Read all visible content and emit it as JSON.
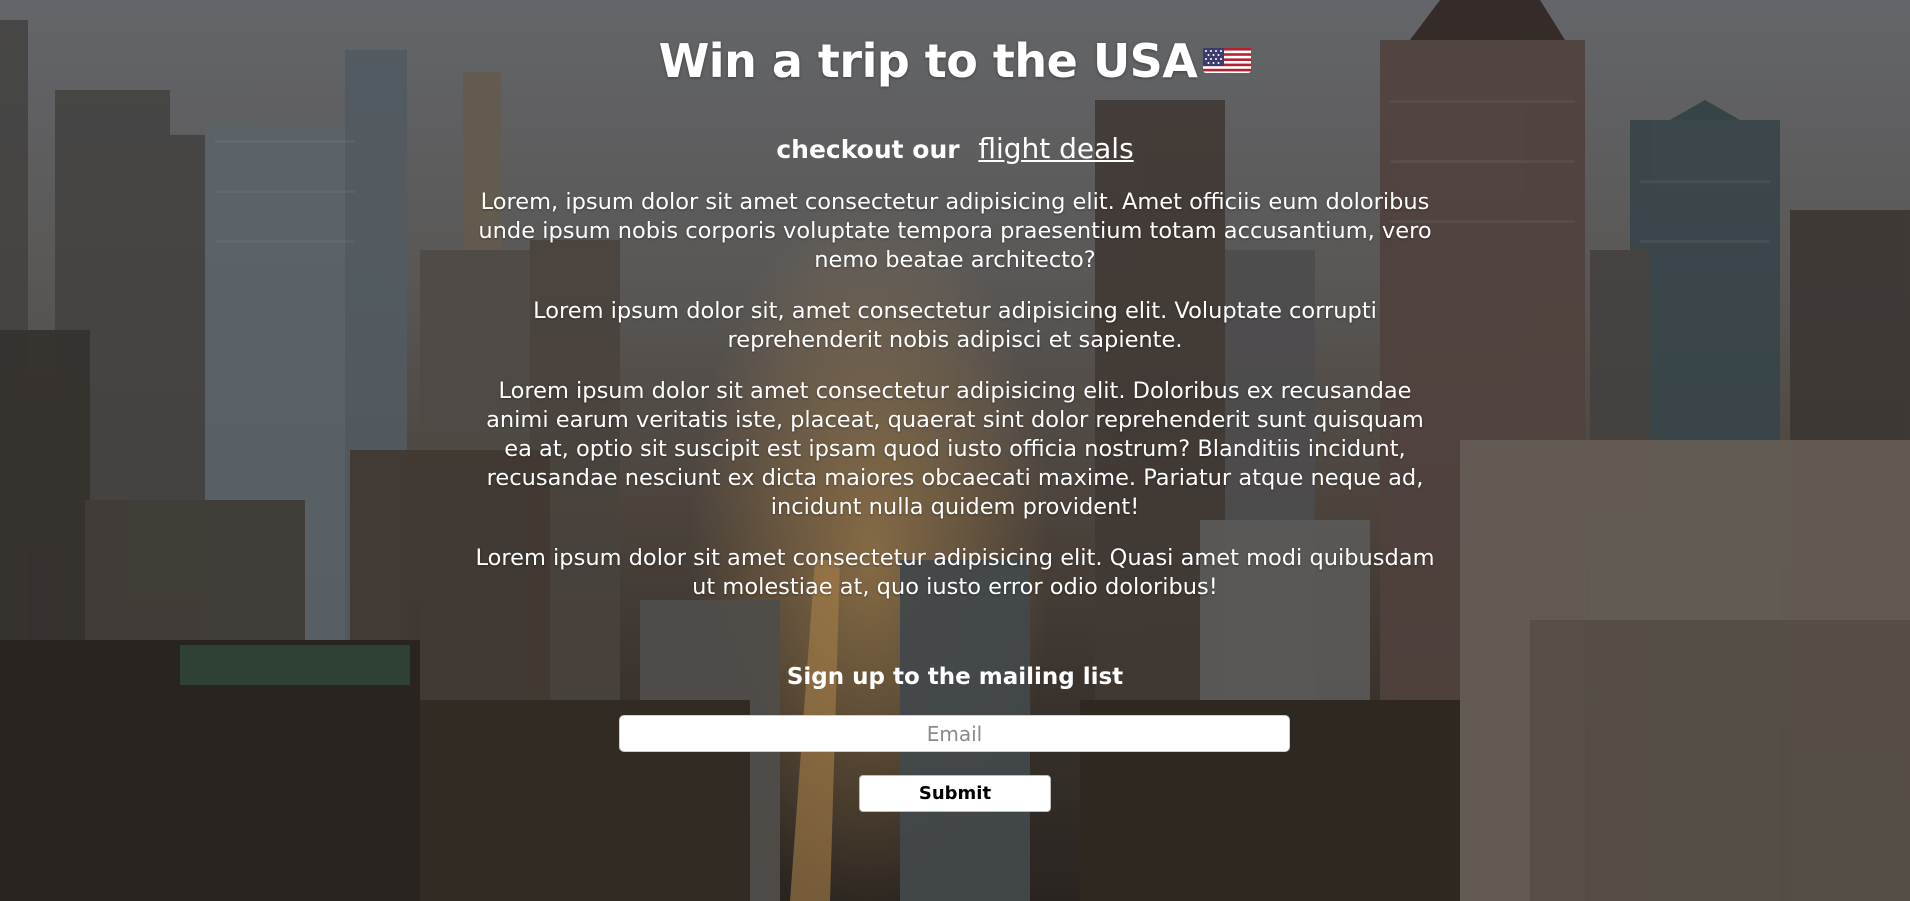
{
  "hero": {
    "title": "Win a trip to the USA",
    "flag_icon": "us-flag-icon"
  },
  "checkout": {
    "text": "checkout our",
    "link_text": "flight deals"
  },
  "paragraphs": [
    "Lorem, ipsum dolor sit amet consectetur adipisicing elit. Amet officiis eum doloribus unde ipsum nobis corporis voluptate tempora praesentium totam accusantium, vero nemo beatae architecto?",
    "Lorem ipsum dolor sit, amet consectetur adipisicing elit. Voluptate corrupti reprehenderit nobis adipisci et sapiente.",
    "Lorem ipsum dolor sit amet consectetur adipisicing elit. Doloribus ex recusandae animi earum veritatis iste, placeat, quaerat sint dolor reprehenderit sunt quisquam ea at, optio sit suscipit est ipsam quod iusto officia nostrum? Blanditiis incidunt, recusandae nesciunt ex dicta maiores obcaecati maxime. Pariatur atque neque ad, incidunt nulla quidem provident!",
    "Lorem ipsum dolor sit amet consectetur adipisicing elit. Quasi amet modi quibusdam ut molestiae at, quo iusto error odio doloribus!"
  ],
  "signup": {
    "label": "Sign up to the mailing list",
    "email_placeholder": "Email",
    "email_value": "",
    "submit_label": "Submit"
  },
  "background": {
    "description_icon": "city-skyline-background",
    "sky_color": "#8a8d93",
    "sun_glow_color": "#ffc46e"
  }
}
